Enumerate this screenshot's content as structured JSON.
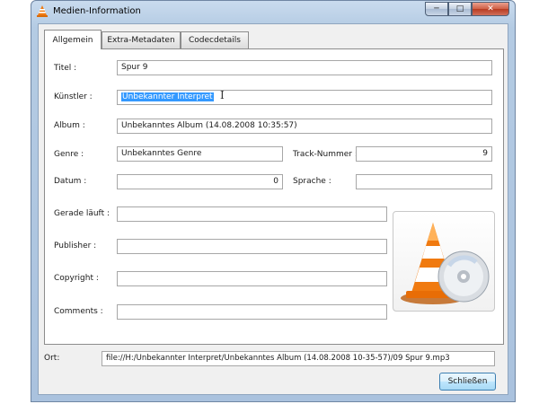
{
  "window": {
    "title": "Medien-Information",
    "min_glyph": "─",
    "max_glyph": "□",
    "close_glyph": "✕"
  },
  "tabs": [
    "Allgemein",
    "Extra-Metadaten",
    "Codecdetails"
  ],
  "fields": {
    "titel": {
      "label": "Titel :",
      "value": "Spur 9"
    },
    "kuenstler": {
      "label": "Künstler :",
      "value": "Unbekannter Interpret"
    },
    "album": {
      "label": "Album :",
      "value": "Unbekanntes Album (14.08.2008 10:35:57)"
    },
    "genre": {
      "label": "Genre :",
      "value": "Unbekanntes Genre"
    },
    "track": {
      "label": "Track-Nummer :",
      "value": "9"
    },
    "datum": {
      "label": "Datum :",
      "value": "0"
    },
    "sprache": {
      "label": "Sprache :",
      "value": ""
    },
    "gerade": {
      "label": "Gerade läuft :",
      "value": ""
    },
    "publisher": {
      "label": "Publisher :",
      "value": ""
    },
    "copyright": {
      "label": "Copyright :",
      "value": ""
    },
    "comments": {
      "label": "Comments :",
      "value": ""
    }
  },
  "ort": {
    "label": "Ort:",
    "value": "file://H:/Unbekannter Interpret/Unbekanntes Album (14.08.2008 10-35-57)/09 Spur 9.mp3"
  },
  "buttons": {
    "close_label": "Schließen"
  },
  "art": {
    "icon": "vlc-cone-with-cd-icon"
  },
  "colors": {
    "selection": "#3399ff",
    "cone_orange": "#f07a10"
  }
}
